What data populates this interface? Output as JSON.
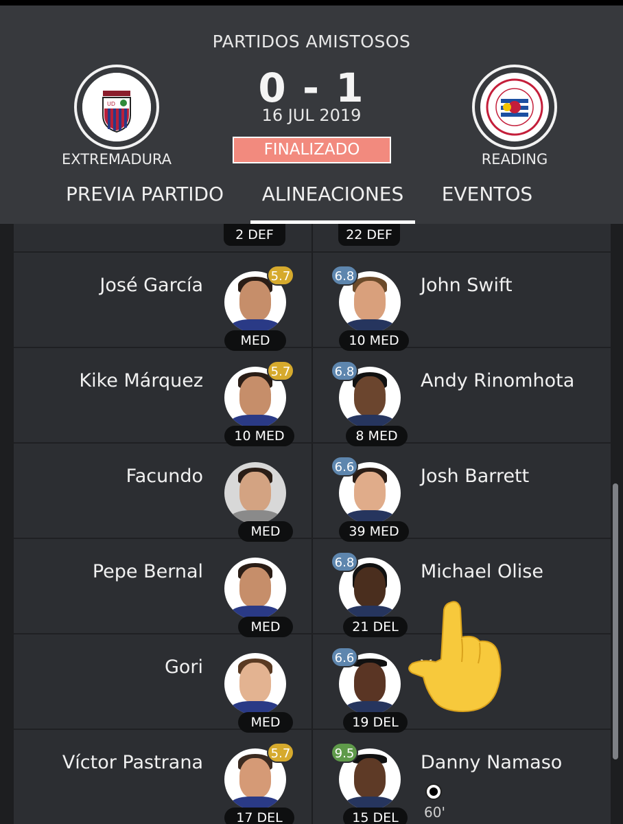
{
  "header": {
    "competition": "PARTIDOS AMISTOSOS",
    "score": "0 - 1",
    "date": "16 JUL 2019",
    "status": "FINALIZADO",
    "home_team": "EXTREMADURA",
    "away_team": "READING",
    "colors": {
      "status_bg": "#f28a7e",
      "header_bg": "#37393d"
    }
  },
  "tabs": [
    {
      "label": "PREVIA PARTIDO"
    },
    {
      "label": "ALINEACIONES",
      "active": true
    },
    {
      "label": "EVENTOS"
    }
  ],
  "top_positions": {
    "home": "2 DEF",
    "away": "22 DEF"
  },
  "rows": [
    {
      "home": {
        "name": "José García",
        "pos": "MED",
        "rating": "5.7"
      },
      "away": {
        "name": "John Swift",
        "pos": "10 MED",
        "rating": "6.8"
      }
    },
    {
      "home": {
        "name": "Kike Márquez",
        "pos": "10 MED",
        "rating": "5.7"
      },
      "away": {
        "name": "Andy Rinomhota",
        "pos": "8 MED",
        "rating": "6.8"
      }
    },
    {
      "home": {
        "name": "Facundo",
        "pos": "MED",
        "rating": ""
      },
      "away": {
        "name": "Josh Barrett",
        "pos": "39 MED",
        "rating": "6.6"
      }
    },
    {
      "home": {
        "name": "Pepe Bernal",
        "pos": "MED",
        "rating": ""
      },
      "away": {
        "name": "Michael Olise",
        "pos": "21 DEL",
        "rating": "6.8"
      }
    },
    {
      "home": {
        "name": "Gori",
        "pos": "MED",
        "rating": ""
      },
      "away": {
        "name": "Ya         ité",
        "pos": "19 DEL",
        "rating": "6.6"
      }
    },
    {
      "home": {
        "name": "Víctor Pastrana",
        "pos": "17 DEL",
        "rating": "5.7"
      },
      "away": {
        "name": "Danny Namaso",
        "pos": "15 DEL",
        "rating": "9.5",
        "goal_minute": "60'"
      }
    }
  ],
  "icons": {
    "goal": "soccer-ball-icon",
    "pointer": "pointing-hand-emoji"
  }
}
